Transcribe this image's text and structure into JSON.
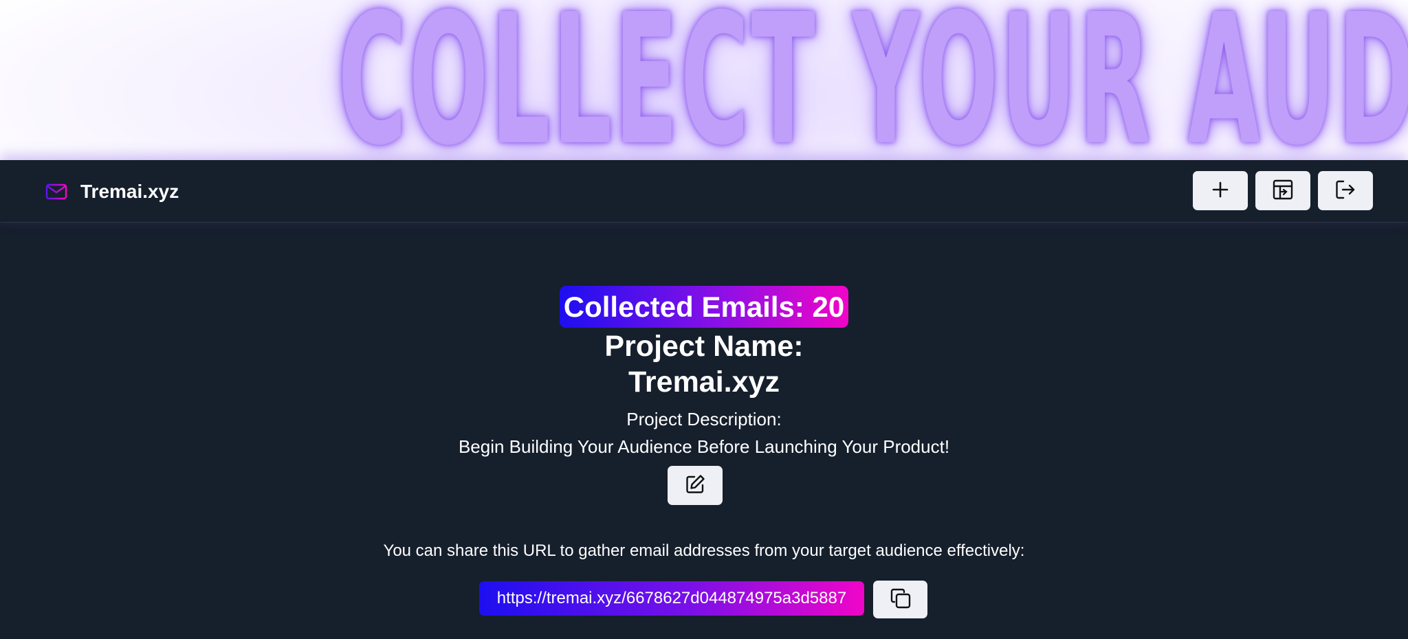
{
  "hero": {
    "text": "COLLECT YOUR AUDIENCE"
  },
  "navbar": {
    "brand_name": "Tremai.xyz",
    "buttons": [
      {
        "icon": "plus-icon"
      },
      {
        "icon": "dashboard-icon"
      },
      {
        "icon": "logout-icon"
      }
    ]
  },
  "main": {
    "counter_label": "Collected Emails: 20",
    "project_name_label": "Project Name:",
    "project_name": "Tremai.xyz",
    "description_label": "Project Description:",
    "description": "Begin Building Your Audience Before Launching Your Product!",
    "share_text": "You can share this URL to gather email addresses from your target audience effectively:",
    "share_url": "https://tremai.xyz/6678627d044874975a3d5887"
  },
  "colors": {
    "background": "#161f2c",
    "hero_text": "#bf9ff9",
    "gradient_start": "#1d0ff0",
    "gradient_end": "#f005c8",
    "button_bg": "#eef0f6"
  }
}
